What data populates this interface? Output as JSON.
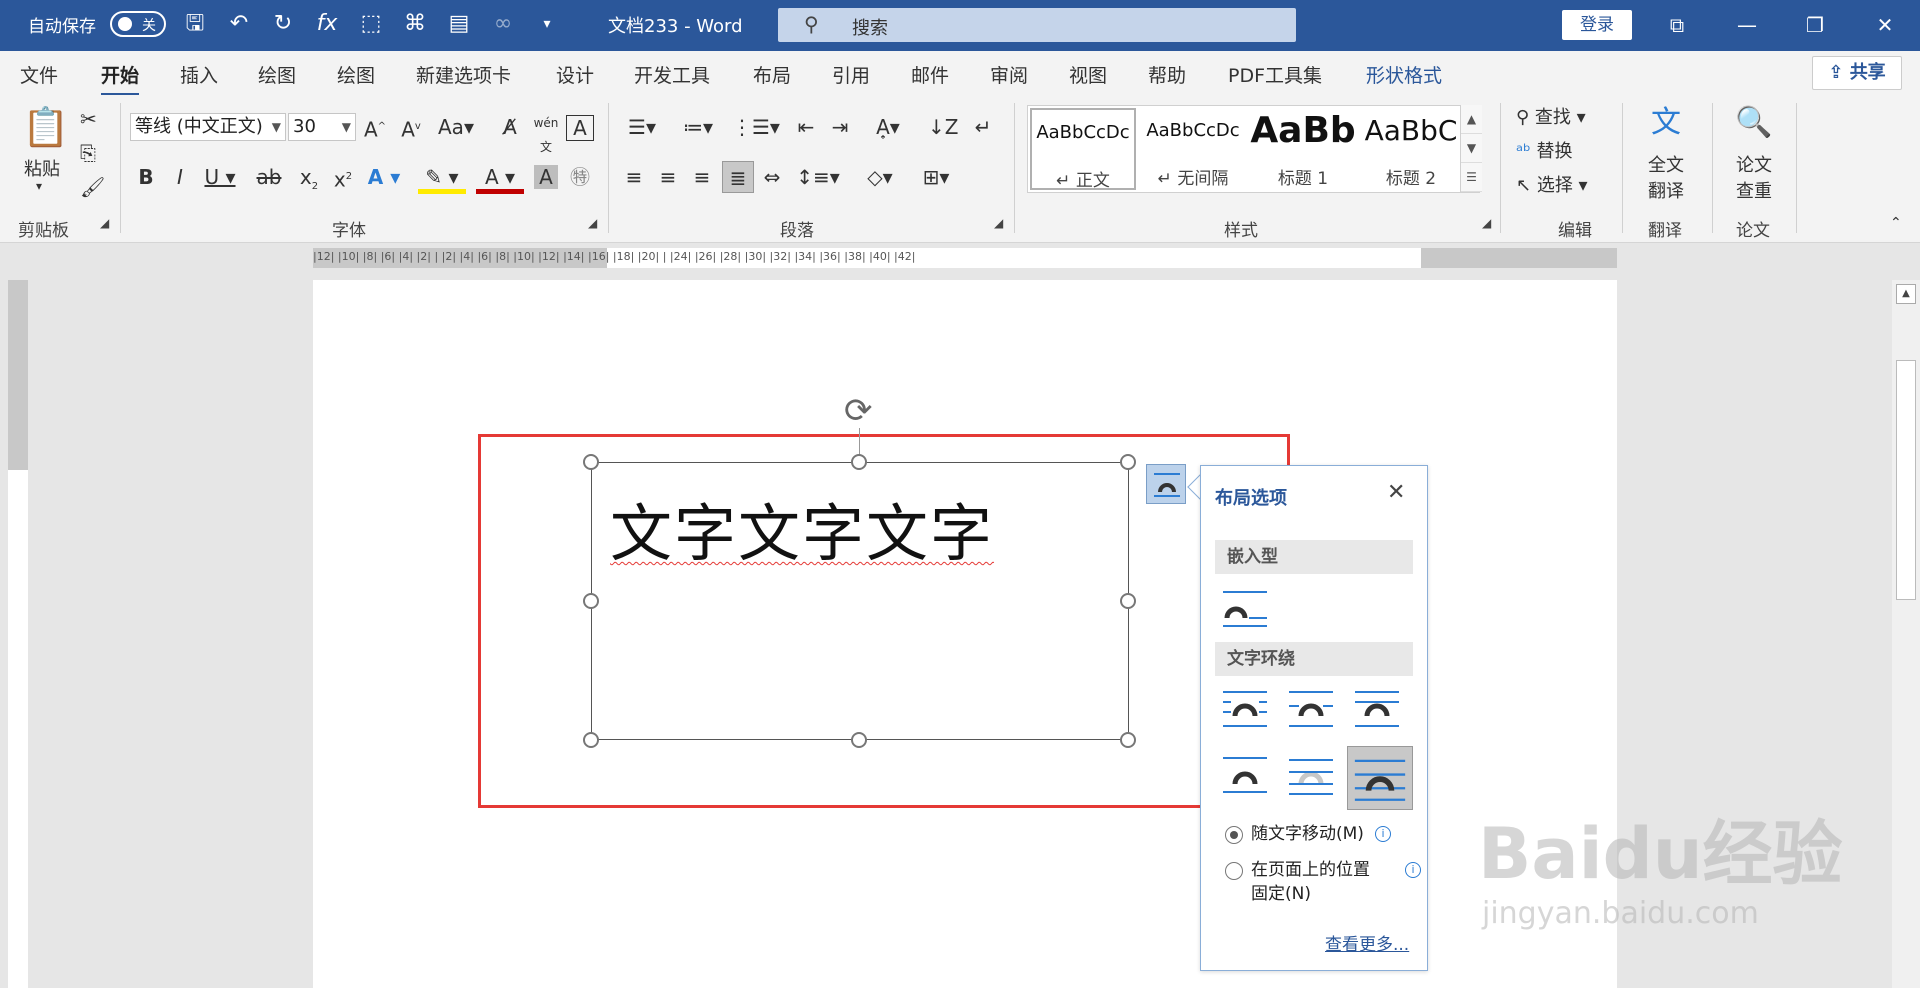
{
  "titlebar": {
    "autosave_label": "自动保存",
    "autosave_state": "关",
    "doc_title": "文档233  -  Word",
    "search_placeholder": "搜索",
    "login_label": "登录"
  },
  "tabs": [
    "文件",
    "开始",
    "插入",
    "绘图",
    "绘图",
    "新建选项卡",
    "设计",
    "开发工具",
    "布局",
    "引用",
    "邮件",
    "审阅",
    "视图",
    "帮助",
    "PDF工具集",
    "形状格式"
  ],
  "active_tab": "开始",
  "share_label": "共享",
  "ribbon": {
    "clipboard": {
      "paste": "粘贴",
      "group": "剪贴板"
    },
    "font": {
      "name": "等线 (中文正文)",
      "size": "30",
      "group": "字体"
    },
    "paragraph": {
      "group": "段落"
    },
    "styles": {
      "group": "样式",
      "items": [
        {
          "sample": "AaBbCcDc",
          "name": "正文"
        },
        {
          "sample": "AaBbCcDc",
          "name": "无间隔"
        },
        {
          "sample": "AaBb",
          "name": "标题 1"
        },
        {
          "sample": "AaBbC",
          "name": "标题 2"
        }
      ]
    },
    "editing": {
      "find": "查找",
      "replace": "替换",
      "select": "选择",
      "group": "编辑"
    },
    "translate": {
      "btn_line1": "全文",
      "btn_line2": "翻译",
      "group": "翻译"
    },
    "paper": {
      "btn_line1": "论文",
      "btn_line2": "查重",
      "group": "论文"
    }
  },
  "ruler_text": "|12|  |10|  |8|  |6|  |4|  |2|  |  |2|  |4|  |6|  |8|  |10|  |12|  |14|  |16|  |18|  |20|  |  |24|  |26|  |28|  |30|  |32|  |34|  |36|  |38|  |40|  |42|",
  "document": {
    "textbox_text": "文字文字文字"
  },
  "layout_panel": {
    "title": "布局选项",
    "inline_section": "嵌入型",
    "wrap_section": "文字环绕",
    "move_with_text": "随文字移动(M)",
    "fix_position_line1": "在页面上的位置",
    "fix_position_line2": "固定(N)",
    "see_more": "查看更多..."
  },
  "watermark": {
    "logo": "Baidu经验",
    "url": "jingyan.baidu.com"
  },
  "colors": {
    "titlebar": "#2b579a",
    "highlight_box": "#e53935",
    "link": "#2b579a"
  }
}
